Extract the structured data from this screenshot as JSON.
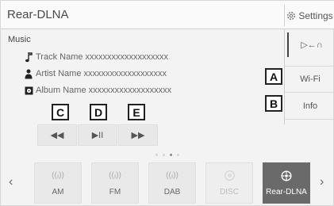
{
  "header": {
    "title": "Rear-DLNA",
    "settings_label": "Settings"
  },
  "section": {
    "label": "Music"
  },
  "track": {
    "track": "Track Name xxxxxxxxxxxxxxxxxxx",
    "artist": "Artist Name xxxxxxxxxxxxxxxxxxx",
    "album": "Album Name xxxxxxxxxxxxxxxxxxx"
  },
  "callouts": {
    "a": "A",
    "b": "B",
    "c": "C",
    "d": "D",
    "e": "E"
  },
  "controls": {
    "prev": "◀◀",
    "playpause": "▶II",
    "next": "▶▶"
  },
  "right_panel": {
    "bt_icon": "▷←∩",
    "wifi": "Wi-Fi",
    "info": "Info"
  },
  "sources": [
    {
      "label": "AM",
      "icon": "radio-wave-icon",
      "state": "normal"
    },
    {
      "label": "FM",
      "icon": "radio-wave-icon",
      "state": "normal"
    },
    {
      "label": "DAB",
      "icon": "radio-wave-icon",
      "state": "normal"
    },
    {
      "label": "DISC",
      "icon": "disc-icon",
      "state": "disabled"
    },
    {
      "label": "Rear-DLNA",
      "icon": "dlna-icon",
      "state": "active"
    }
  ],
  "nav": {
    "prev": "‹",
    "next": "›"
  },
  "colors": {
    "background": "#f3f3f3",
    "active_source": "#6a6a6a",
    "callout_border": "#222222"
  }
}
